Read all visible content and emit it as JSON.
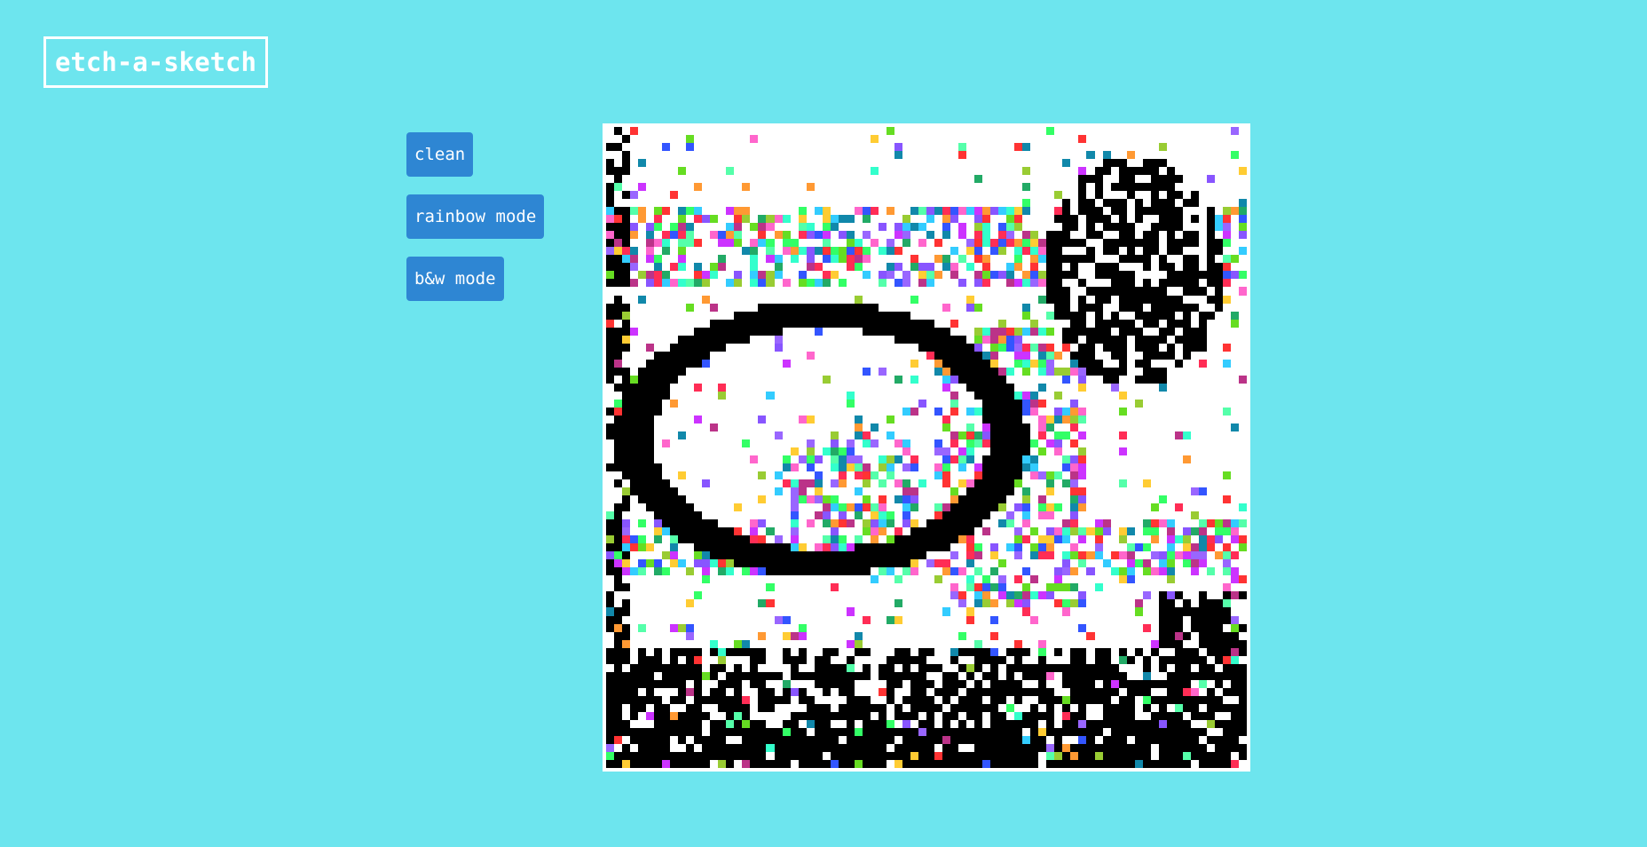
{
  "header": {
    "title": "etch-a-sketch"
  },
  "controls": {
    "clean_label": "clean",
    "rainbow_label": "rainbow mode",
    "bw_label": "b&w mode"
  },
  "board": {
    "grid_size": 80,
    "background": "#ffffff",
    "ink_color": "#000000",
    "rainbow_palette": [
      "#ff2d55",
      "#ff66cc",
      "#cc33ff",
      "#9966ff",
      "#3355ff",
      "#33ccff",
      "#33ffcc",
      "#33ff66",
      "#66dd22",
      "#99cc33",
      "#ffcc33",
      "#ff9933",
      "#ff3333",
      "#22aa66",
      "#1188aa",
      "#bb3388",
      "#8855ff",
      "#55ffaa"
    ]
  },
  "colors": {
    "page_background": "#6de5ee",
    "button_background": "#2e86d3",
    "text_light": "#ffffff"
  }
}
